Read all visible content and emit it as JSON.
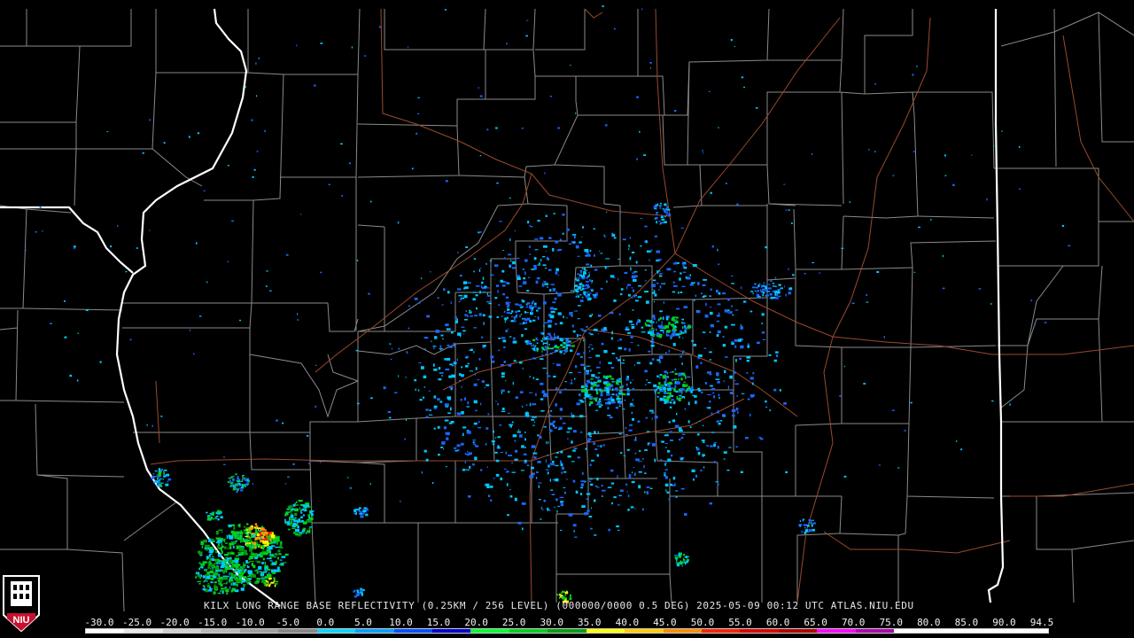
{
  "product": {
    "caption": "KILX LONG RANGE BASE REFLECTIVITY (0.25KM / 256 LEVEL) (000000/0000 0.5 DEG) 2025-05-09 00:12 UTC  ATLAS.NIU.EDU"
  },
  "logo": {
    "text": "NIU",
    "colors": {
      "red": "#c8102e",
      "white": "#ffffff",
      "black": "#000000"
    }
  },
  "color_scale": {
    "labels": [
      "-30.0",
      "-25.0",
      "-20.0",
      "-15.0",
      "-10.0",
      "-5.0",
      "0.0",
      "5.0",
      "10.0",
      "15.0",
      "20.0",
      "25.0",
      "30.0",
      "35.0",
      "40.0",
      "45.0",
      "50.0",
      "55.0",
      "60.0",
      "65.0",
      "70.0",
      "75.0",
      "80.0",
      "85.0",
      "90.0",
      "94.5"
    ],
    "colors": [
      "#ffffff",
      "#e8e8e8",
      "#d0d0d0",
      "#b8b8b8",
      "#a0a0a0",
      "#888888",
      "#00d8ff",
      "#00a0ff",
      "#0050ff",
      "#0000cc",
      "#00ff30",
      "#00d020",
      "#00a010",
      "#ffff00",
      "#ffcc00",
      "#ff8c00",
      "#ff2000",
      "#dd0000",
      "#b00000",
      "#ff00ff",
      "#b000b0",
      "#ffffff",
      "#ffffff",
      "#ffffff",
      "#ffffff"
    ]
  },
  "map_style": {
    "county_color": "#8a8a8a",
    "state_color": "#ffffff",
    "highway_color": "#9a4a2e",
    "background": "#000000"
  },
  "echo_colors": {
    "light_cyan": "#00c8ff",
    "blue": "#1a66ff",
    "green": "#00d020",
    "dark_green": "#009a10",
    "yellow": "#ffff00",
    "orange": "#ff9c00",
    "red": "#ff2000"
  }
}
